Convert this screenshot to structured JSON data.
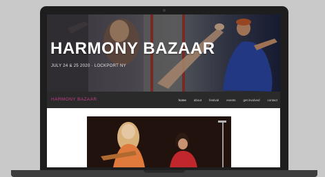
{
  "site": {
    "title": "HARMONY BAZAAR",
    "event_meta": "JULY 24 & 25 2020  ·  LOCKPORT NY",
    "brand": "HARMONY BAZAAR"
  },
  "nav": {
    "items": [
      {
        "label": "home",
        "active": true
      },
      {
        "label": "about",
        "active": false
      },
      {
        "label": "festival",
        "active": false
      },
      {
        "label": "events",
        "active": false
      },
      {
        "label": "get involved",
        "active": false
      },
      {
        "label": "contact",
        "active": false
      }
    ]
  },
  "colors": {
    "brand_accent": "#c43d8a",
    "nav_background": "#2a2a2a",
    "page_background": "#c9c9c9"
  }
}
